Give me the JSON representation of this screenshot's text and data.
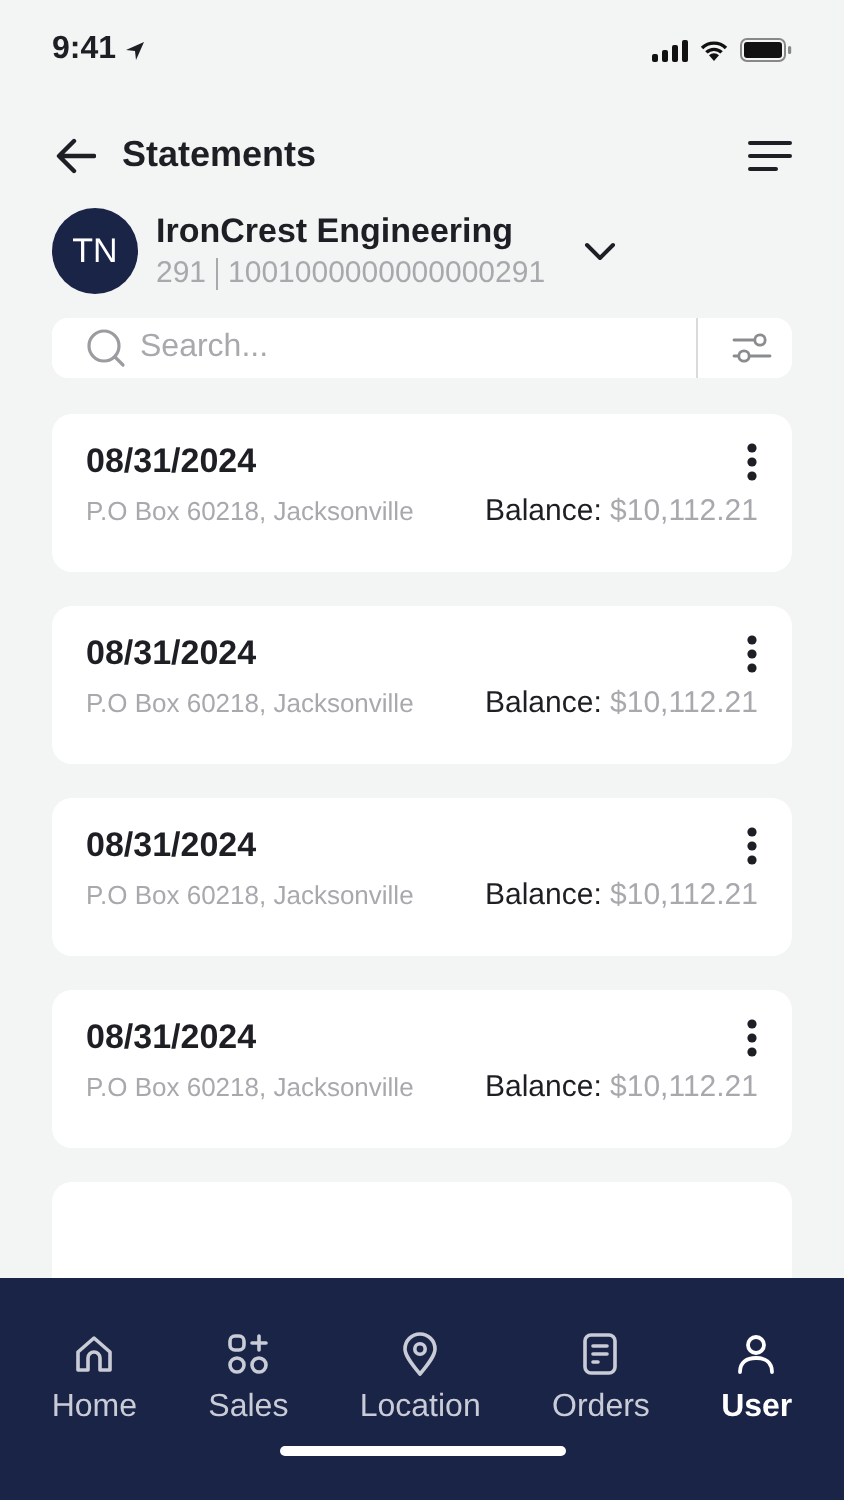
{
  "status_bar": {
    "time": "9:41"
  },
  "header": {
    "title": "Statements"
  },
  "account": {
    "initials": "TN",
    "name": "IronCrest Engineering",
    "number": "291",
    "account_id": "1001000000000000291"
  },
  "search": {
    "placeholder": "Search..."
  },
  "statements": [
    {
      "date": "08/31/2024",
      "address": "P.O Box 60218, Jacksonville",
      "balance_label": "Balance:",
      "balance": "$10,112.21"
    },
    {
      "date": "08/31/2024",
      "address": "P.O Box 60218, Jacksonville",
      "balance_label": "Balance:",
      "balance": "$10,112.21"
    },
    {
      "date": "08/31/2024",
      "address": "P.O Box 60218, Jacksonville",
      "balance_label": "Balance:",
      "balance": "$10,112.21"
    },
    {
      "date": "08/31/2024",
      "address": "P.O Box 60218, Jacksonville",
      "balance_label": "Balance:",
      "balance": "$10,112.21"
    }
  ],
  "tab_bar": [
    {
      "label": "Home",
      "kind": "home",
      "selected": false
    },
    {
      "label": "Sales",
      "kind": "sales",
      "selected": false
    },
    {
      "label": "Location",
      "kind": "location",
      "selected": false
    },
    {
      "label": "Orders",
      "kind": "orders",
      "selected": false
    },
    {
      "label": "User",
      "kind": "user",
      "selected": true
    }
  ]
}
